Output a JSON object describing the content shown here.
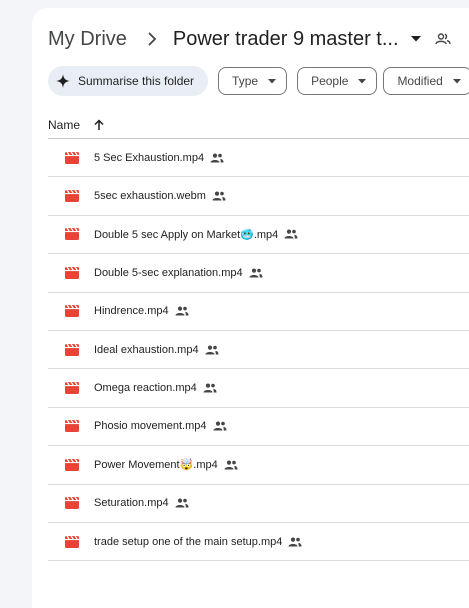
{
  "breadcrumb": {
    "root": "My Drive",
    "separator": "›",
    "current": "Power trader 9 master t..."
  },
  "toolbar": {
    "summarise_label": "Summarise this folder",
    "filters": [
      {
        "label": "Type"
      },
      {
        "label": "People"
      },
      {
        "label": "Modified"
      }
    ]
  },
  "table": {
    "column_name": "Name",
    "sort": "ascending"
  },
  "files": [
    {
      "name": "5 Sec Exhaustion.mp4",
      "shared": true
    },
    {
      "name": "5sec exhaustion.webm",
      "shared": true
    },
    {
      "name": "Double 5 sec Apply on Market🥶.mp4",
      "shared": true
    },
    {
      "name": "Double 5-sec explanation.mp4",
      "shared": true
    },
    {
      "name": "Hindrence.mp4",
      "shared": true
    },
    {
      "name": "Ideal exhaustion.mp4",
      "shared": true
    },
    {
      "name": "Omega reaction.mp4",
      "shared": true
    },
    {
      "name": "Phosio movement.mp4",
      "shared": true
    },
    {
      "name": "Power Movement🤯.mp4",
      "shared": true
    },
    {
      "name": "Seturation.mp4",
      "shared": true
    },
    {
      "name": "trade setup one of the main setup.mp4",
      "shared": true
    }
  ],
  "icons": {
    "file": "video-file-icon",
    "shared": "people-icon",
    "sort": "arrow-up-icon",
    "sparkle": "sparkle-icon"
  },
  "colors": {
    "video_icon": "#ea4335",
    "chip_bg": "#e9eef6",
    "panel_bg": "#ffffff",
    "page_bg": "#f3f5f9"
  }
}
